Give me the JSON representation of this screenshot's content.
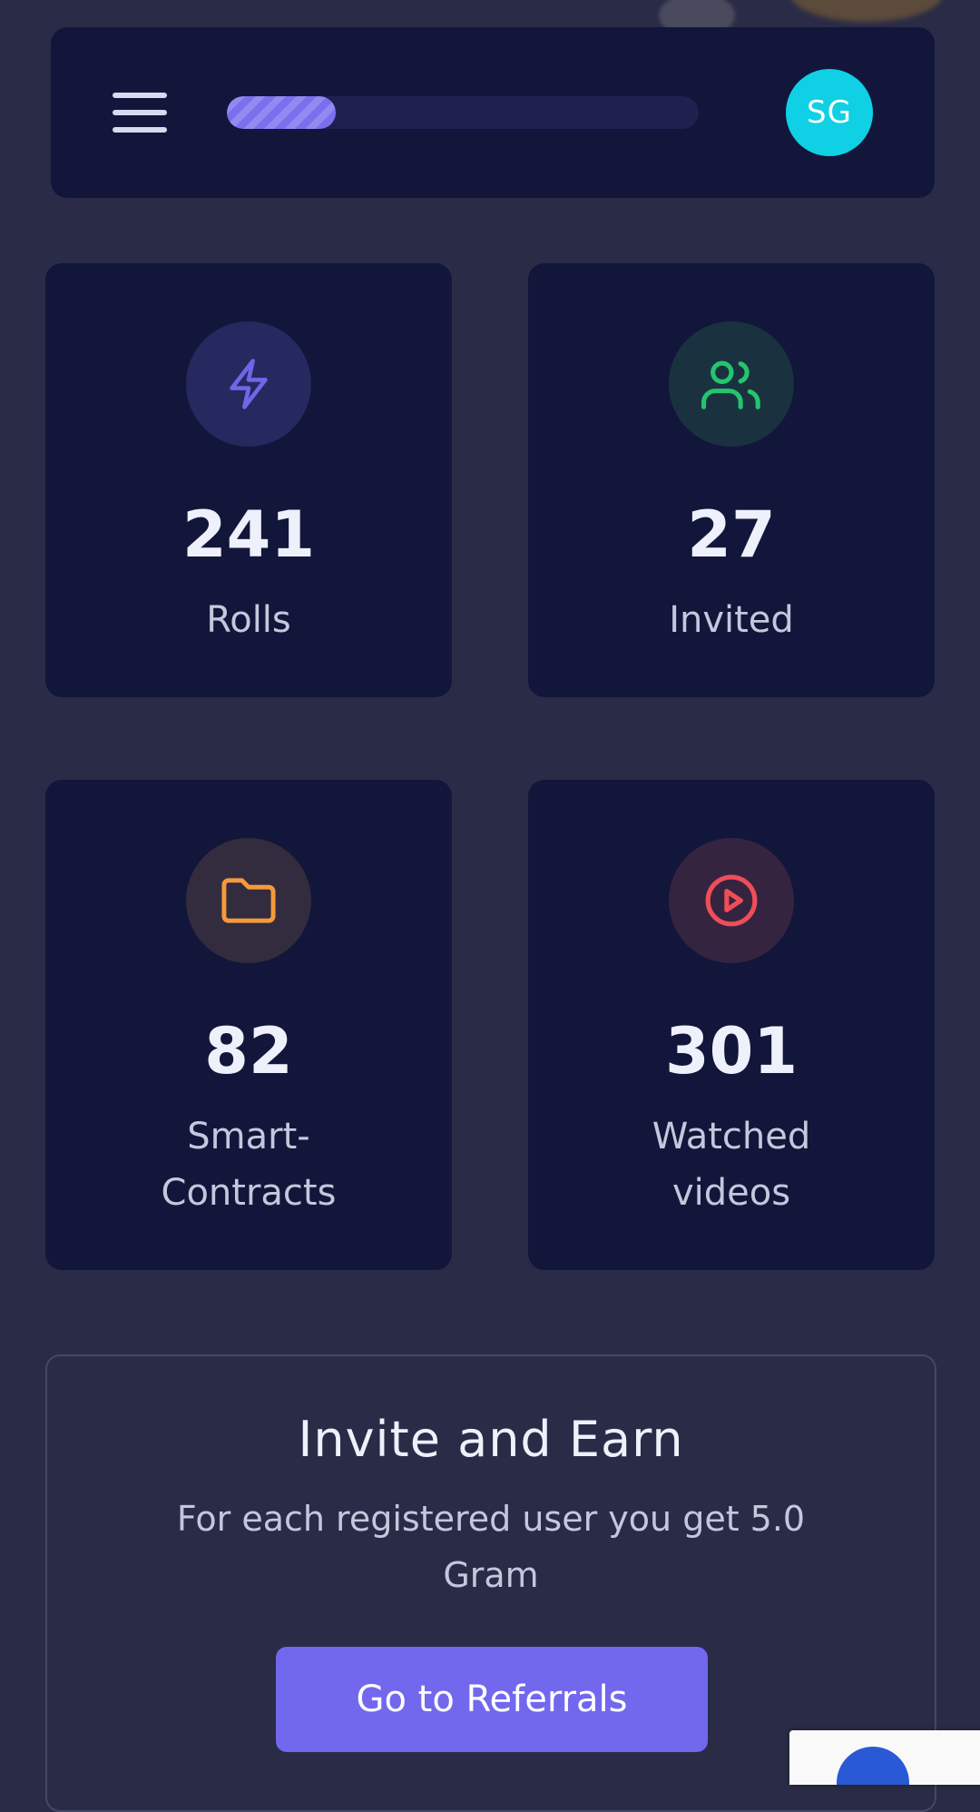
{
  "header": {
    "menu_icon": "menu-icon",
    "progress": 0.23,
    "avatar_initials": "SG",
    "avatar_color": "#0fd0e4",
    "accent": "#7a70ee"
  },
  "stats": [
    {
      "value": "241",
      "label": "Rolls",
      "icon": "lightning-icon",
      "icon_color": "#6f66e8",
      "circle_color": "#262860"
    },
    {
      "value": "27",
      "label": "Invited",
      "icon": "users-icon",
      "icon_color": "#24c56e",
      "circle_color": "#1a3240"
    },
    {
      "value": "82",
      "label": "Smart-Contracts",
      "icon": "folder-icon",
      "icon_color": "#f59a3c",
      "circle_color": "#332c3e"
    },
    {
      "value": "301",
      "label": "Watched videos",
      "icon": "play-circle-icon",
      "icon_color": "#ef4d57",
      "circle_color": "#352440"
    }
  ],
  "invite": {
    "title": "Invite and Earn",
    "text": "For each registered user you get 5.0 Gram",
    "button_label": "Go to Referrals",
    "button_color": "#7268ee"
  }
}
